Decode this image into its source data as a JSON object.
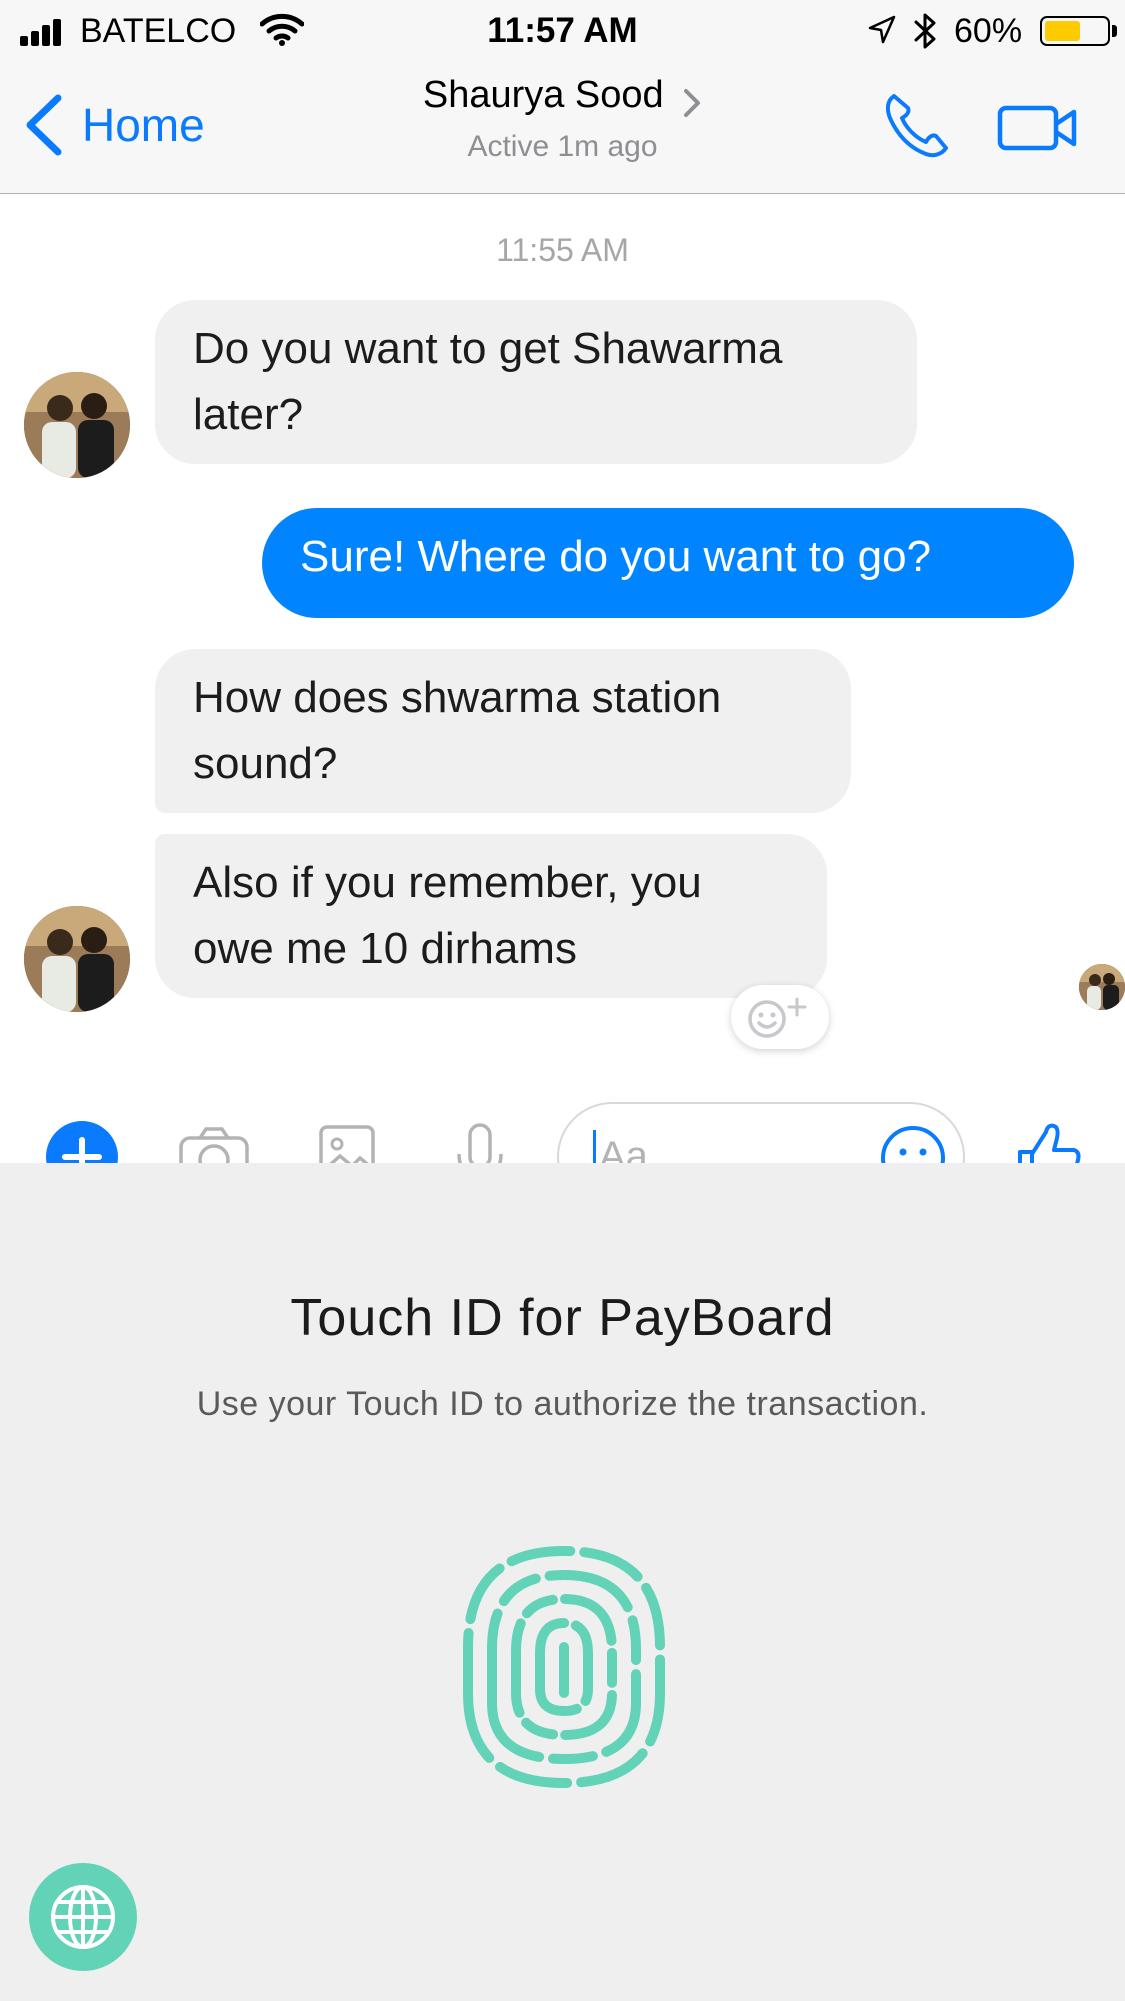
{
  "status_bar": {
    "carrier": "BATELCO",
    "time": "11:57 AM",
    "battery_percent": "60%",
    "battery_level": 0.6,
    "battery_color": "#fecb00",
    "icons": [
      "signal-icon",
      "wifi-icon",
      "location-icon",
      "bluetooth-icon",
      "battery-icon"
    ]
  },
  "header": {
    "back_label": "Home",
    "contact_name": "Shaurya Sood",
    "contact_status": "Active 1m ago",
    "icons": [
      "chevron-left-icon",
      "chevron-right-icon",
      "phone-icon",
      "video-camera-icon"
    ],
    "accent_color": "#0a7aff"
  },
  "chat": {
    "timestamp": "11:55 AM",
    "messages": [
      {
        "direction": "received",
        "lines": [
          "Do you want to get Shawarma",
          "later?"
        ]
      },
      {
        "direction": "sent",
        "lines": [
          "Sure! Where do you want to go?"
        ]
      },
      {
        "direction": "received",
        "lines": [
          "How does shwarma station",
          "sound?"
        ]
      },
      {
        "direction": "received",
        "lines": [
          "Also if you remember, you",
          "owe me 10 dirhams"
        ]
      }
    ],
    "sent_bubble_color": "#0084ff",
    "received_bubble_color": "#f0f0f0"
  },
  "composer": {
    "placeholder": "Aa",
    "icons": [
      "plus-icon",
      "camera-icon",
      "photo-icon",
      "microphone-icon",
      "emoji-icon",
      "thumbs-up-icon"
    ]
  },
  "touch_id": {
    "title": "Touch ID for PayBoard",
    "subtitle": "Use your Touch ID to authorize the transaction.",
    "fingerprint_color": "#63d3b8",
    "icons": [
      "fingerprint-icon",
      "globe-icon"
    ]
  }
}
